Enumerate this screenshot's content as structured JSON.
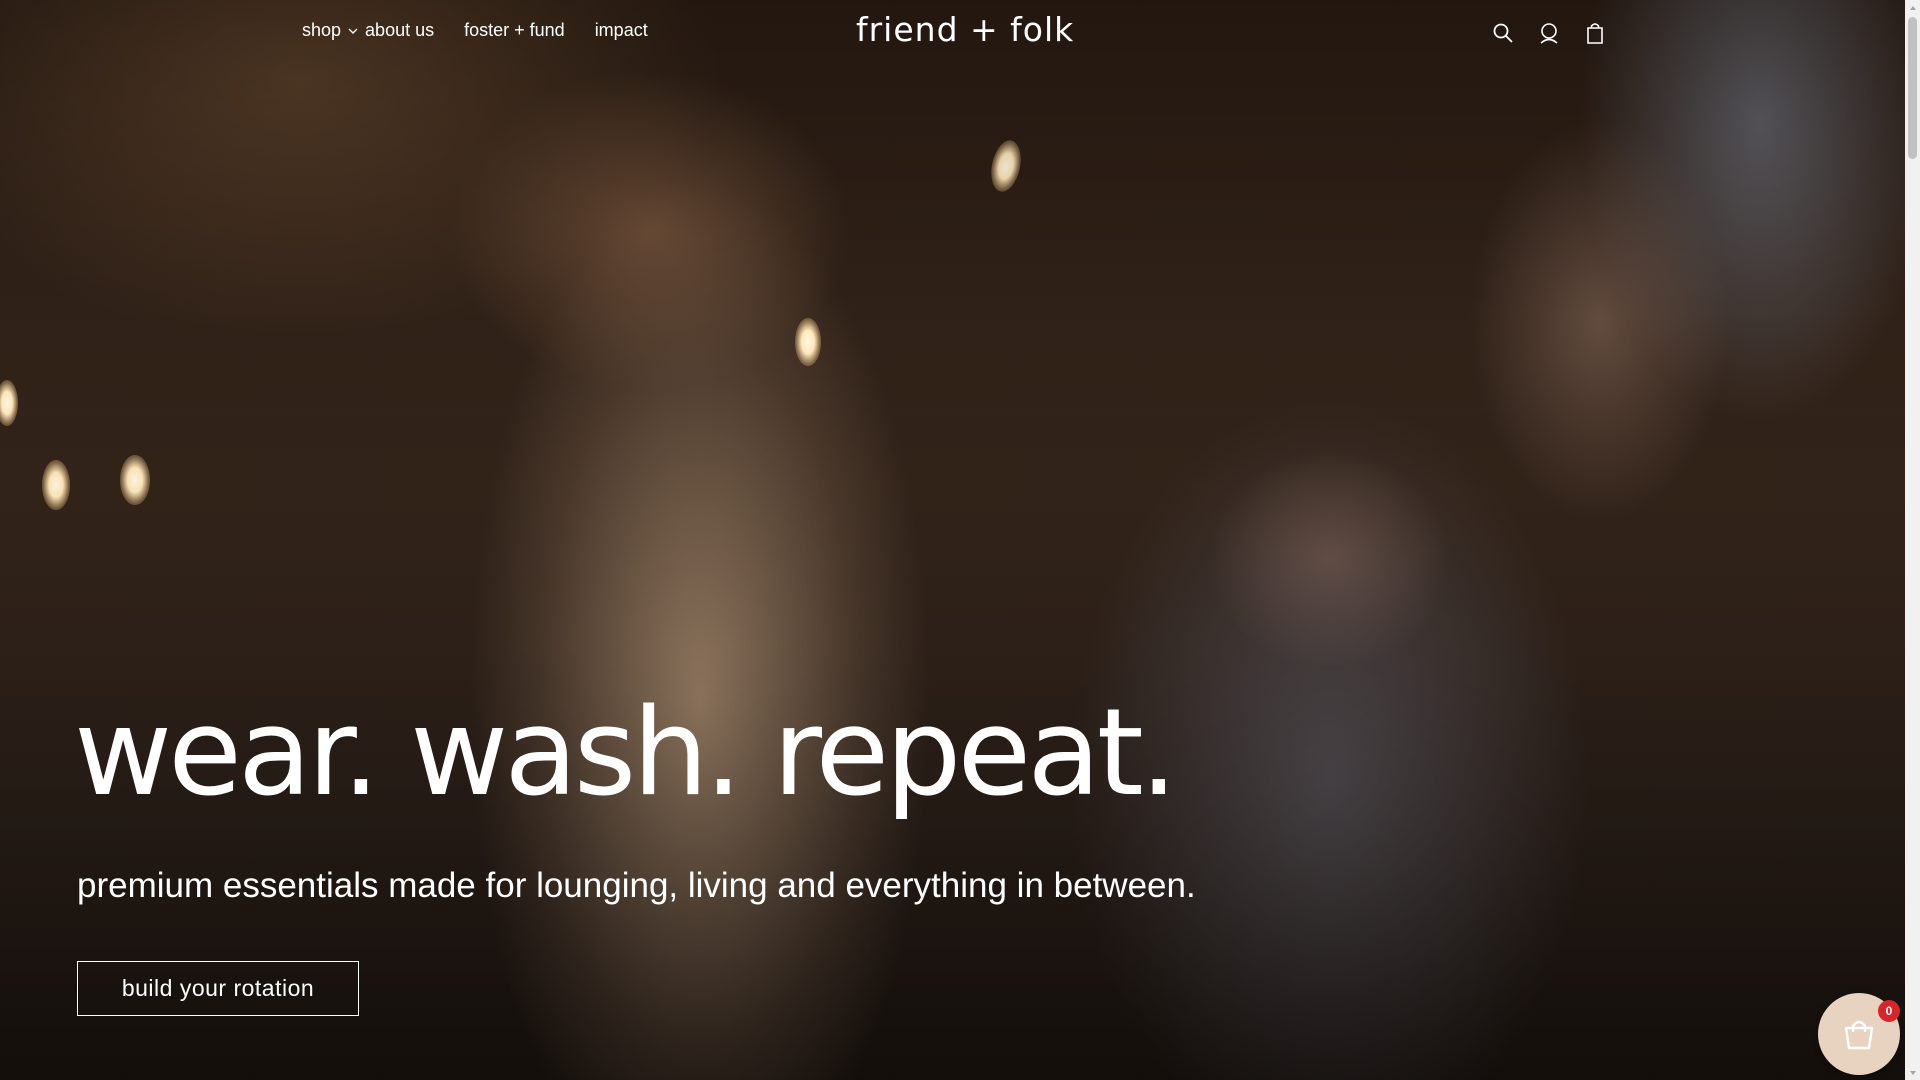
{
  "header": {
    "nav": [
      {
        "label": "shop",
        "has_dropdown": true
      },
      {
        "label": "about us"
      },
      {
        "label": "foster + fund"
      },
      {
        "label": "impact"
      }
    ],
    "logo_text": "friend + folk",
    "icons": [
      "search-icon",
      "account-icon",
      "cart-icon"
    ]
  },
  "hero": {
    "headline": "wear. wash. repeat.",
    "subheadline": "premium essentials made for lounging, living and everything in between.",
    "cta_label": "build your rotation"
  },
  "floating_cart": {
    "icon": "shopping-bag-icon",
    "count": "0",
    "background": "#e8d2c0",
    "badge_color": "#d6262b"
  }
}
